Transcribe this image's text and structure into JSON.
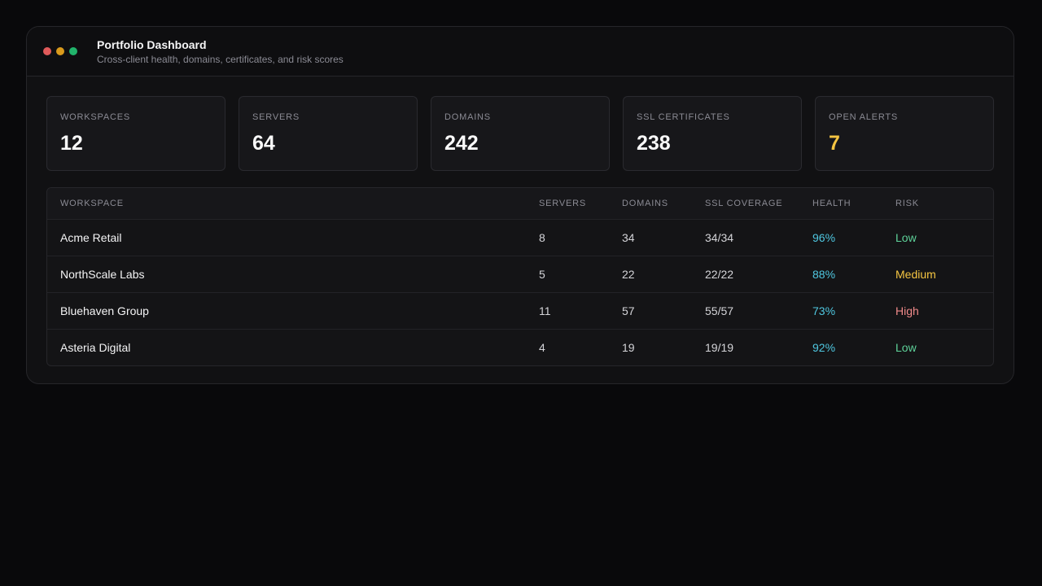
{
  "header": {
    "title": "Portfolio Dashboard",
    "subtitle": "Cross-client health, domains, certificates, and risk scores",
    "window_dots": [
      "#e05a5a",
      "#d99a1c",
      "#21b36b"
    ]
  },
  "stats": [
    {
      "label": "WORKSPACES",
      "value": "12",
      "color": "#fafafa"
    },
    {
      "label": "SERVERS",
      "value": "64",
      "color": "#fafafa"
    },
    {
      "label": "DOMAINS",
      "value": "242",
      "color": "#fafafa"
    },
    {
      "label": "SSL CERTIFICATES",
      "value": "238",
      "color": "#fafafa"
    },
    {
      "label": "OPEN ALERTS",
      "value": "7",
      "color": "#f5c542"
    }
  ],
  "table": {
    "columns": [
      "WORKSPACE",
      "SERVERS",
      "DOMAINS",
      "SSL COVERAGE",
      "HEALTH",
      "RISK"
    ],
    "rows": [
      {
        "workspace": "Acme Retail",
        "servers": "8",
        "domains": "34",
        "ssl": "34/34",
        "health": "96%",
        "risk": "Low"
      },
      {
        "workspace": "NorthScale Labs",
        "servers": "5",
        "domains": "22",
        "ssl": "22/22",
        "health": "88%",
        "risk": "Medium"
      },
      {
        "workspace": "Bluehaven Group",
        "servers": "11",
        "domains": "57",
        "ssl": "55/57",
        "health": "73%",
        "risk": "High"
      },
      {
        "workspace": "Asteria Digital",
        "servers": "4",
        "domains": "19",
        "ssl": "19/19",
        "health": "92%",
        "risk": "Low"
      }
    ]
  },
  "colors": {
    "health": "#4fc7e0",
    "risk_low": "#5ed39a",
    "risk_medium": "#f5c542",
    "risk_high": "#f08a8a"
  }
}
